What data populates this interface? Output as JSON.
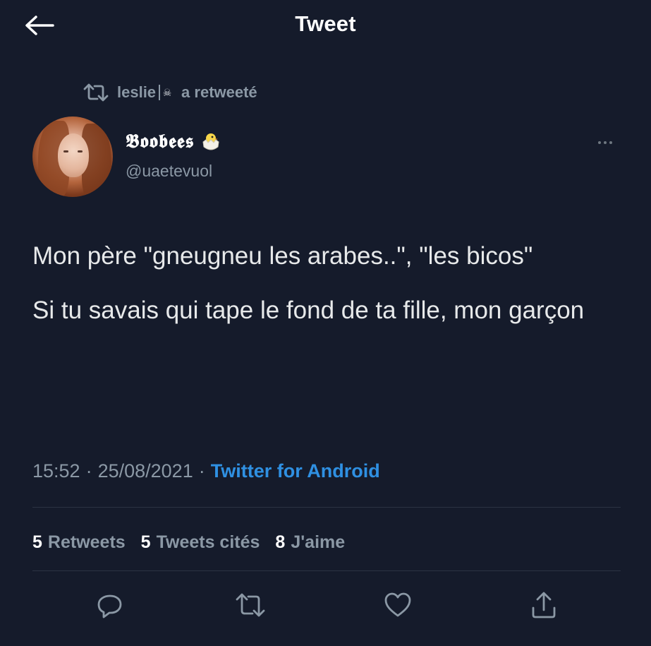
{
  "header": {
    "title": "Tweet",
    "back_icon": "arrow-left-icon"
  },
  "retweet_context": {
    "icon": "retweet-icon",
    "user": "leslie",
    "badge_icon": "pirate-flag-icon",
    "label": "a retweeté"
  },
  "author": {
    "display_name": "𝕭𝖔𝖔𝖇𝖊𝖊𝖘",
    "emoji": "🐣",
    "handle": "@uaetevuol",
    "avatar_icon": "profile-photo"
  },
  "tweet": {
    "paragraphs": [
      "Mon père \"gneugneu les arabes..\", \"les bicos\"",
      "Si tu savais qui tape le fond de ta fille, mon garçon"
    ],
    "time": "15:52",
    "separator": "·",
    "date": "25/08/2021",
    "source": "Twitter for Android"
  },
  "stats": {
    "retweets": {
      "count": "5",
      "label": "Retweets"
    },
    "quotes": {
      "count": "5",
      "label": "Tweets cités"
    },
    "likes": {
      "count": "8",
      "label": "J'aime"
    }
  },
  "actions": [
    "reply-icon",
    "retweet-icon",
    "like-icon",
    "share-icon"
  ],
  "colors": {
    "background": "#151b2b",
    "accent": "#2f90e2",
    "muted": "#8b98a5",
    "text": "#e7e9ea"
  }
}
